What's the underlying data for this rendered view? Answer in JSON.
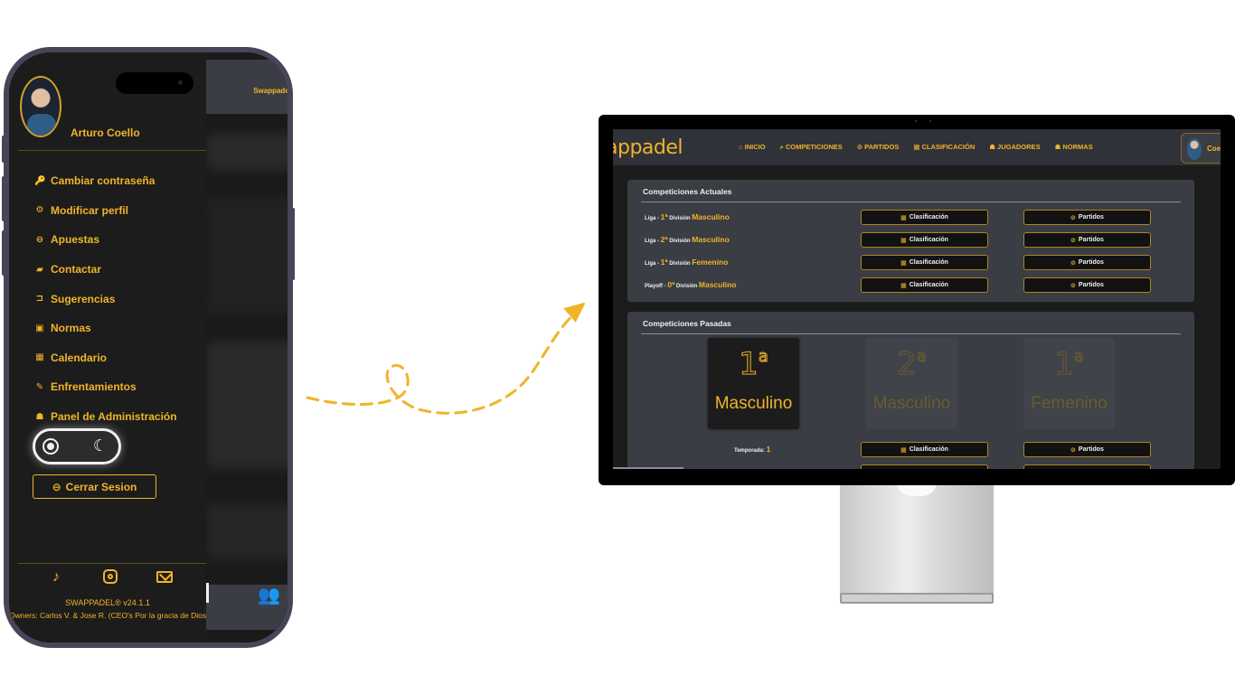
{
  "phone": {
    "bg_logo": "Swappadel",
    "user_name": "Arturo Coello",
    "menu": [
      {
        "icon": "key-icon",
        "glyph": "🔑",
        "label": "Cambiar contraseña"
      },
      {
        "icon": "gear-icon",
        "glyph": "⚙",
        "label": "Modificar perfil"
      },
      {
        "icon": "ticket-icon",
        "glyph": "⊖",
        "label": "Apuestas"
      },
      {
        "icon": "chat-icon",
        "glyph": "▰",
        "label": "Contactar"
      },
      {
        "icon": "suggestion-icon",
        "glyph": "⊐",
        "label": "Sugerencias"
      },
      {
        "icon": "book-icon",
        "glyph": "▣",
        "label": "Normas"
      },
      {
        "icon": "calendar-icon",
        "glyph": "▦",
        "label": "Calendario"
      },
      {
        "icon": "versus-icon",
        "glyph": "✎",
        "label": "Enfrentamientos"
      },
      {
        "icon": "admin-icon",
        "glyph": "☗",
        "label": "Panel de Administración"
      }
    ],
    "theme_toggle_moon": "☾",
    "logout_icon": "⊖",
    "logout_label": "Cerrar Sesion",
    "social_tiktok": "♪",
    "version": "SWAPPADEL® v24.1.1",
    "owners": "Owners: Carlos V. & Jose R. (CEO's Por la gracia de Dios)",
    "bg_footer_icon": "👥"
  },
  "desktop": {
    "logo": "appadel",
    "nav": [
      {
        "icon": "home-icon",
        "label": "⌂ INICIO"
      },
      {
        "icon": "search-icon",
        "label": "⌕ COMPETICIONES"
      },
      {
        "icon": "ball-icon",
        "label": "⊘ PARTIDOS"
      },
      {
        "icon": "table-icon",
        "label": "▦ CLASIFICACIÓN"
      },
      {
        "icon": "users-icon",
        "label": "☗ JUGADORES"
      },
      {
        "icon": "users-icon",
        "label": "☗ NORMAS"
      }
    ],
    "user_short": "Coel",
    "current": {
      "title": "Competiciones Actuales",
      "rows": [
        {
          "prefix": "Liga - ",
          "num": "1ª",
          "mid": " División ",
          "gender": "Masculino"
        },
        {
          "prefix": "Liga - ",
          "num": "2ª",
          "mid": " División ",
          "gender": "Masculino"
        },
        {
          "prefix": "Liga - ",
          "num": "1ª",
          "mid": " División ",
          "gender": "Femenino"
        },
        {
          "prefix": "Playoff - ",
          "num": "0ª",
          "mid": " División ",
          "gender": "Masculino"
        }
      ],
      "btn_classification": "Clasificación",
      "btn_matches": "Partidos",
      "btn_classification_icon": "▦",
      "btn_matches_icon": "⊘"
    },
    "past": {
      "title": "Competiciones Pasadas",
      "cards": [
        {
          "num": "1",
          "sup": "a",
          "label": "Masculino"
        },
        {
          "num": "2",
          "sup": "a",
          "label": "Masculino"
        },
        {
          "num": "1",
          "sup": "a",
          "label": "Femenino"
        }
      ],
      "season_label": "Temporada: ",
      "season_value": "1"
    }
  }
}
